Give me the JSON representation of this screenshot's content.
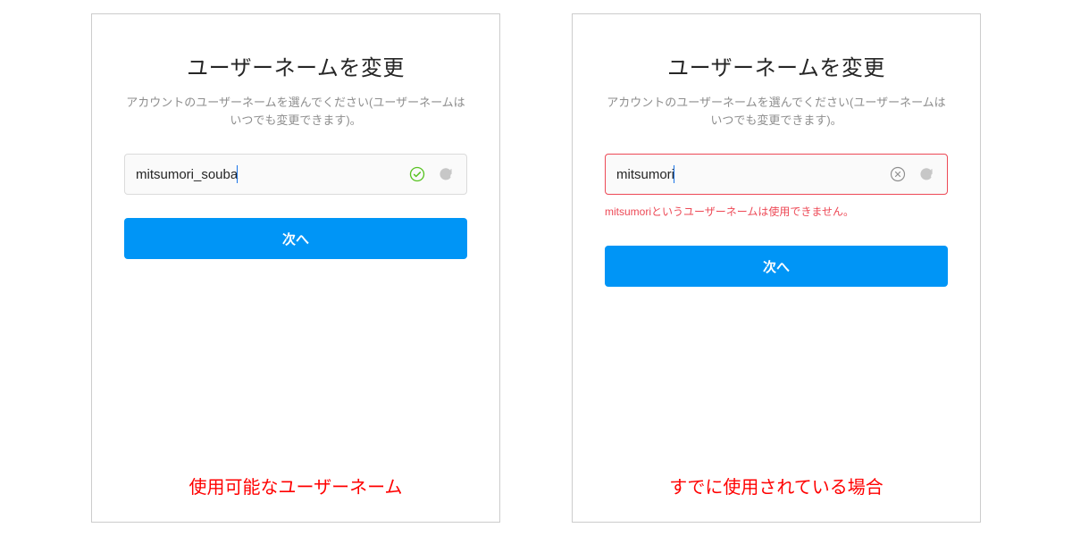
{
  "left": {
    "title": "ユーザーネームを変更",
    "subtitle": "アカウントのユーザーネームを選んでください(ユーザーネームはいつでも変更できます)。",
    "input_value": "mitsumori_souba",
    "input_state": "valid",
    "button_label": "次へ",
    "caption": "使用可能なユーザーネーム"
  },
  "right": {
    "title": "ユーザーネームを変更",
    "subtitle": "アカウントのユーザーネームを選んでください(ユーザーネームはいつでも変更できます)。",
    "input_value": "mitsumori",
    "input_state": "error",
    "error_message": "mitsumoriというユーザーネームは使用できません。",
    "button_label": "次へ",
    "caption": "すでに使用されている場合"
  },
  "colors": {
    "primary": "#0095f6",
    "error": "#ed4956",
    "success": "#58c322",
    "text_muted": "#8e8e8e"
  }
}
